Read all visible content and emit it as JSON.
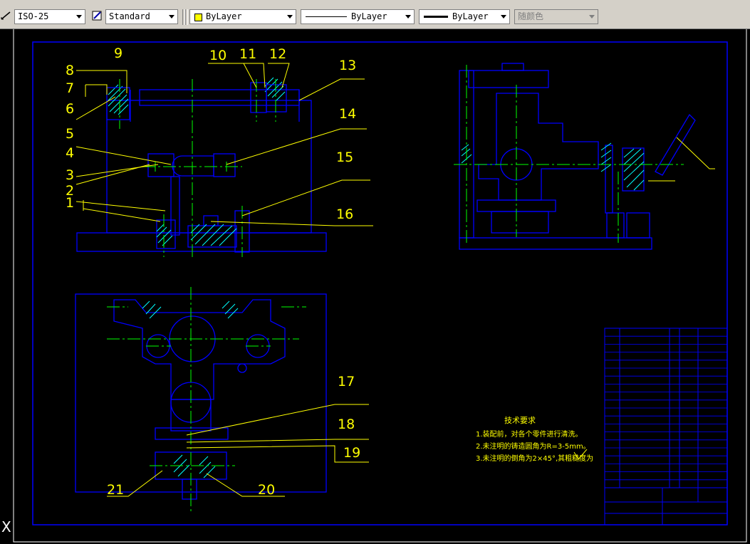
{
  "toolbar": {
    "dim_style": {
      "value": "ISO-25"
    },
    "text_style": {
      "value": "Standard"
    },
    "layer": {
      "value": "ByLayer"
    },
    "linetype": {
      "value": "ByLayer"
    },
    "lineweight": {
      "value": "ByLayer"
    },
    "plot_style": {
      "value": "随颜色"
    }
  },
  "colors": {
    "canvas": "#000000",
    "frame": "#0000ff",
    "center": "#00ff00",
    "label": "#ffff00",
    "hatch": "#00ffff"
  },
  "part_labels": [
    "1",
    "2",
    "3",
    "4",
    "5",
    "6",
    "7",
    "8",
    "9",
    "10",
    "11",
    "12",
    "13",
    "14",
    "15",
    "16",
    "17",
    "18",
    "19",
    "20",
    "21"
  ],
  "tech_requirements": {
    "title": "技术要求",
    "items": [
      "1.装配前，对各个零件进行清洗。",
      "2.未注明的铸造圆角为R=3-5mm。",
      "3.未注明的倒角为2×45°,其粗糙度为"
    ]
  },
  "command_line": {
    "prompt_icon": "X"
  }
}
